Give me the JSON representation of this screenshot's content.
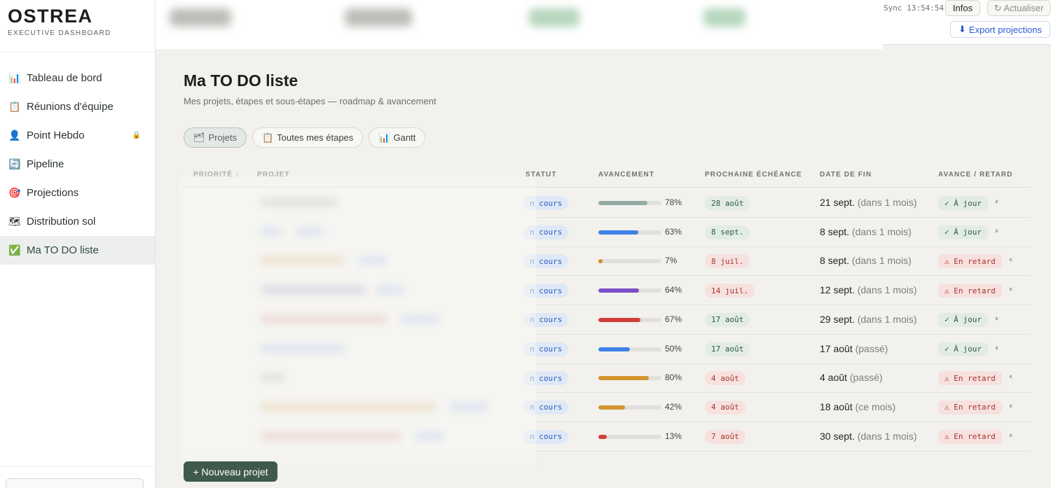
{
  "brand": {
    "name": "OSTREA",
    "subtitle": "EXECUTIVE DASHBOARD"
  },
  "sidebar": {
    "items": [
      {
        "label": "Tableau de bord",
        "icon": "📊"
      },
      {
        "label": "Réunions d'équipe",
        "icon": "📋"
      },
      {
        "label": "Point Hebdo",
        "icon": "👤"
      },
      {
        "label": "Pipeline",
        "icon": "🔄"
      },
      {
        "label": "Projections",
        "icon": "🎯"
      },
      {
        "label": "Distribution sol",
        "icon": "🗺"
      },
      {
        "label": "Ma TO DO liste",
        "icon": "✅",
        "active": true
      }
    ]
  },
  "header": {
    "sync_label": "Sync 13:54:54",
    "infos_label": "Infos",
    "refresh_label": "↻ Actualiser",
    "export_label": "Export projections",
    "export_icon": "⬇"
  },
  "main": {
    "title": "Ma TO DO liste",
    "subtitle": "Mes projets, étapes et sous-étapes — roadmap & avancement",
    "tabs": [
      {
        "icon": "🗂",
        "label": "Projets",
        "active": true
      },
      {
        "icon": "📋",
        "label": "Toutes mes étapes"
      },
      {
        "icon": "📊",
        "label": "Gantt"
      }
    ],
    "columns": {
      "priorite": "PRIORITÉ ↓",
      "projet": "PROJET",
      "statut": "STATUT",
      "avancement": "AVANCEMENT",
      "echeance": "PROCHAINE ÉCHÉANCE",
      "date_fin": "DATE DE FIN",
      "avance": "AVANCE / RETARD"
    },
    "rows": [
      {
        "status": "n cours",
        "progress": 78,
        "progress_label": "78%",
        "progress_color": "#93aba4",
        "due": "28 août",
        "due_state": "ok",
        "end": "21 sept.",
        "end_rel": "(dans 1 mois)",
        "avance": "✓ À jour",
        "avance_state": "ok"
      },
      {
        "status": "n cours",
        "progress": 63,
        "progress_label": "63%",
        "progress_color": "#3f82e6",
        "due": "8 sept.",
        "due_state": "ok",
        "end": "8 sept.",
        "end_rel": "(dans 1 mois)",
        "avance": "✓ À jour",
        "avance_state": "ok"
      },
      {
        "status": "n cours",
        "progress": 7,
        "progress_label": "7%",
        "progress_color": "#d18a2a",
        "due": "8 juil.",
        "due_state": "late",
        "end": "8 sept.",
        "end_rel": "(dans 1 mois)",
        "avance": "⚠ En retard",
        "avance_state": "late"
      },
      {
        "status": "n cours",
        "progress": 64,
        "progress_label": "64%",
        "progress_color": "#7b4fc7",
        "due": "14 juil.",
        "due_state": "late",
        "end": "12 sept.",
        "end_rel": "(dans 1 mois)",
        "avance": "⚠ En retard",
        "avance_state": "late"
      },
      {
        "status": "n cours",
        "progress": 67,
        "progress_label": "67%",
        "progress_color": "#d13e3a",
        "due": "17 août",
        "due_state": "ok",
        "end": "29 sept.",
        "end_rel": "(dans 1 mois)",
        "avance": "✓ À jour",
        "avance_state": "ok"
      },
      {
        "status": "n cours",
        "progress": 50,
        "progress_label": "50%",
        "progress_color": "#3f82e6",
        "due": "17 août",
        "due_state": "ok",
        "end": "17 août",
        "end_rel": "(passé)",
        "avance": "✓ À jour",
        "avance_state": "ok"
      },
      {
        "status": "n cours",
        "progress": 80,
        "progress_label": "80%",
        "progress_color": "#d3952f",
        "due": "4 août",
        "due_state": "late",
        "end": "4 août",
        "end_rel": "(passé)",
        "avance": "⚠ En retard",
        "avance_state": "late"
      },
      {
        "status": "n cours",
        "progress": 42,
        "progress_label": "42%",
        "progress_color": "#d3952f",
        "due": "4 août",
        "due_state": "late",
        "end": "18 août",
        "end_rel": "(ce mois)",
        "avance": "⚠ En retard",
        "avance_state": "late"
      },
      {
        "status": "n cours",
        "progress": 13,
        "progress_label": "13%",
        "progress_color": "#d13e3a",
        "due": "7 août",
        "due_state": "late",
        "end": "30 sept.",
        "end_rel": "(dans 1 mois)",
        "avance": "⚠ En retard",
        "avance_state": "late"
      }
    ],
    "new_project_label": "+ Nouveau projet"
  }
}
